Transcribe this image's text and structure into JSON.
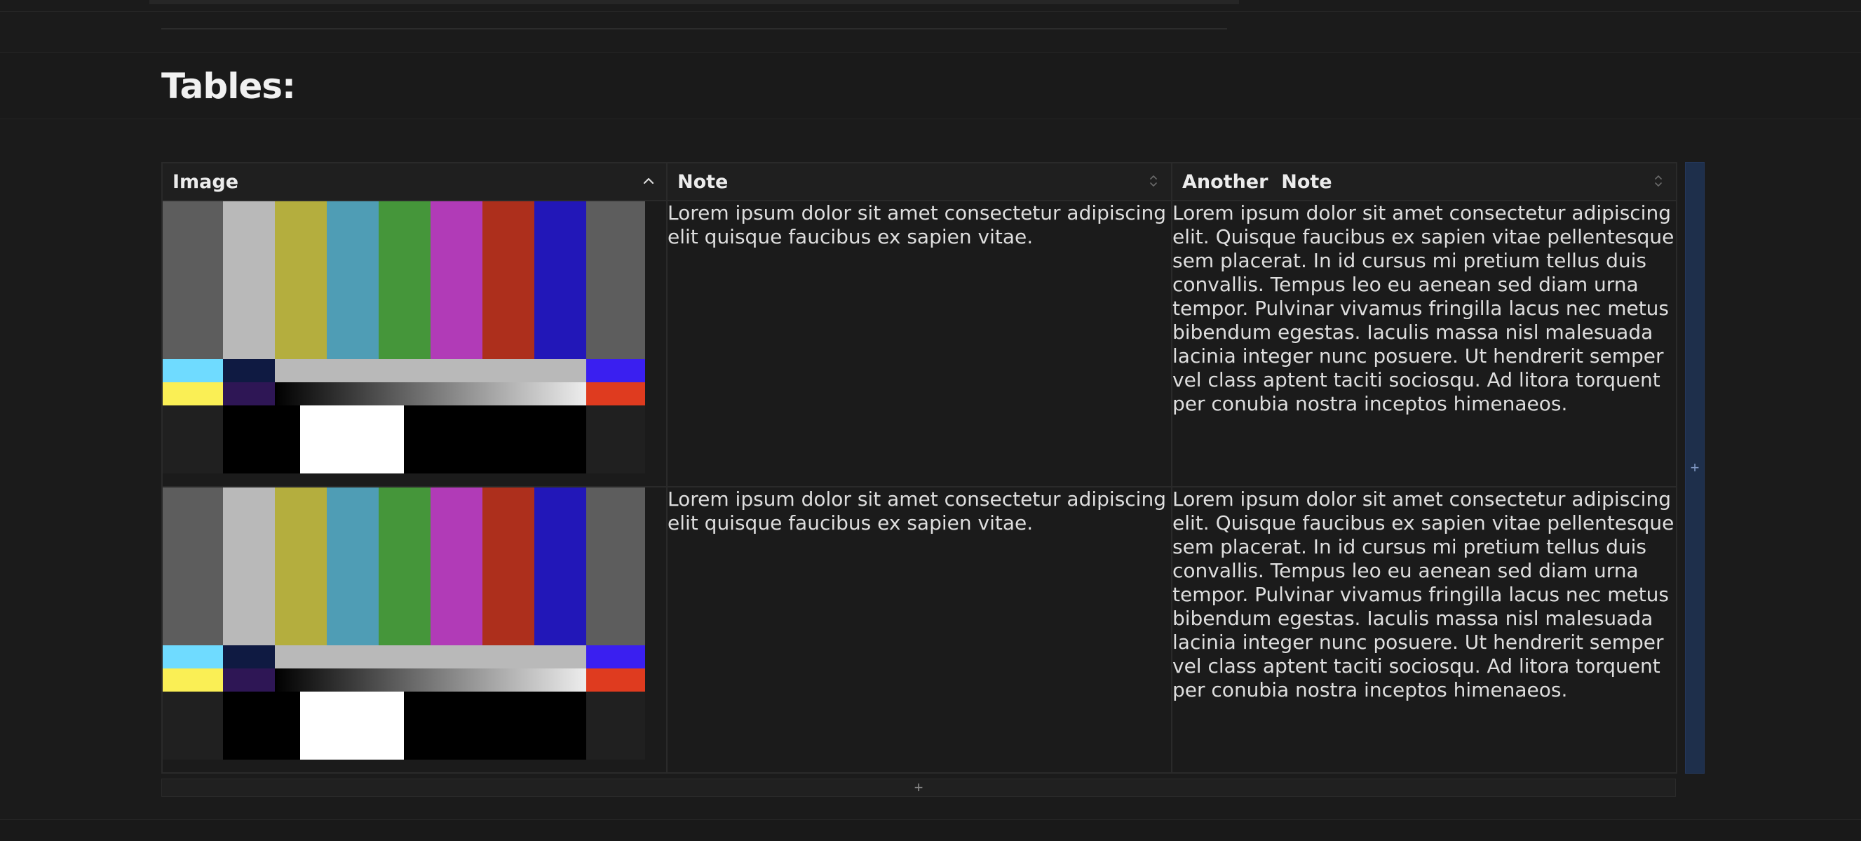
{
  "page": {
    "title": "Tables:"
  },
  "table": {
    "columns": [
      {
        "label": "Image",
        "sort": "ascending"
      },
      {
        "label": "Note",
        "sort": "none"
      },
      {
        "label": "Another  Note",
        "sort": "none"
      }
    ],
    "rows": [
      {
        "image": "tv-test-card",
        "note": "Lorem ipsum dolor sit amet consectetur adipiscing elit quisque faucibus ex sapien vitae.",
        "another_note": "Lorem ipsum dolor sit amet consectetur adipiscing elit. Quisque faucibus ex sapien vitae pellentesque sem placerat. In id cursus mi pretium tellus duis convallis. Tempus leo eu aenean sed diam urna tempor. Pulvinar vivamus fringilla lacus nec metus bibendum egestas. Iaculis massa nisl malesuada lacinia integer nunc posuere. Ut hendrerit semper vel class aptent taciti sociosqu. Ad litora torquent per conubia nostra inceptos himenaeos."
      },
      {
        "image": "tv-test-card",
        "note": "Lorem ipsum dolor sit amet consectetur adipiscing elit quisque faucibus ex sapien vitae.",
        "another_note": "Lorem ipsum dolor sit amet consectetur adipiscing elit. Quisque faucibus ex sapien vitae pellentesque sem placerat. In id cursus mi pretium tellus duis convallis. Tempus leo eu aenean sed diam urna tempor. Pulvinar vivamus fringilla lacus nec metus bibendum egestas. Iaculis massa nisl malesuada lacinia integer nunc posuere. Ut hendrerit semper vel class aptent taciti sociosqu. Ad litora torquent per conubia nostra inceptos himenaeos."
      }
    ],
    "add_column_label": "+",
    "add_row_label": "+"
  },
  "colors": {
    "background": "#1b1b1b",
    "add_column_bar": "#1e2f4b",
    "test_card_bars": [
      "#5d5d5d",
      "#b9b9b9",
      "#b4ae3e",
      "#4f9db5",
      "#45963a",
      "#b13bb7",
      "#ad2f1c",
      "#2217b8",
      "#5d5d5d"
    ]
  },
  "icons": {
    "sort_ascending": "chevron-up-icon",
    "sort_none": "sort-updown-icon"
  }
}
